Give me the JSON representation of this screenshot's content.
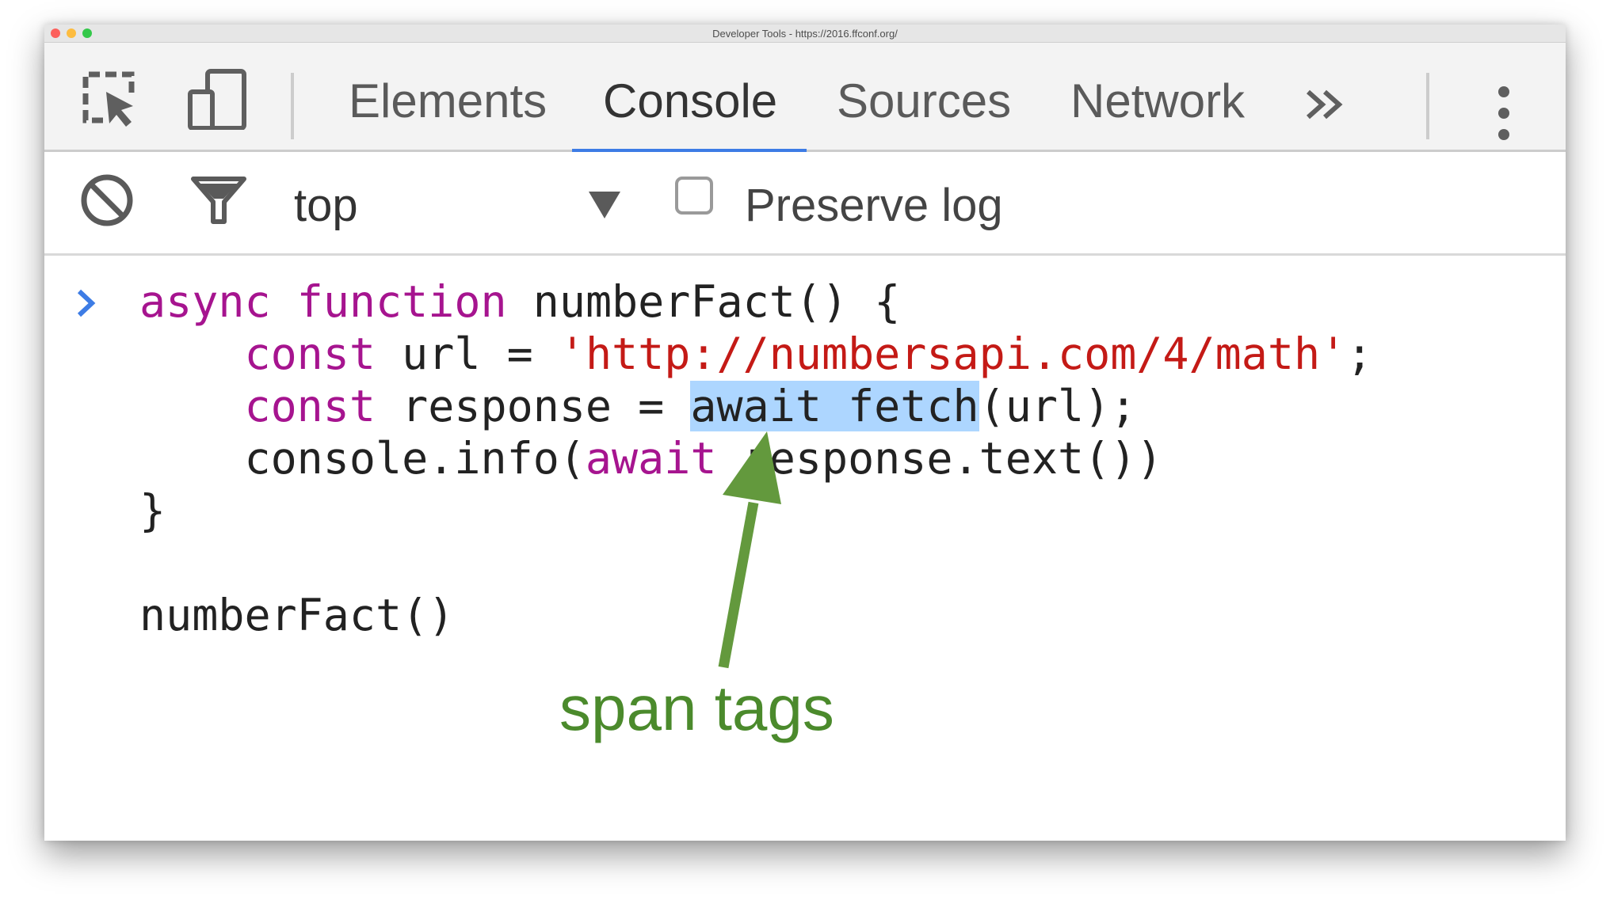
{
  "window": {
    "title": "Developer Tools - https://2016.ffconf.org/"
  },
  "toolbar_icons": {
    "inspect": "inspect-element-icon",
    "device": "device-toolbar-icon",
    "more_tabs": "double-chevron-right-icon",
    "menu": "vertical-dots-icon"
  },
  "tabs": [
    {
      "label": "Elements",
      "active": false
    },
    {
      "label": "Console",
      "active": true
    },
    {
      "label": "Sources",
      "active": false
    },
    {
      "label": "Network",
      "active": false
    }
  ],
  "console_toolbar": {
    "context": "top",
    "preserve_log_label": "Preserve log",
    "preserve_log_checked": false
  },
  "code": {
    "line1": {
      "kw1": "async",
      "sp1": " ",
      "kw2": "function",
      "rest": " numberFact() {"
    },
    "line2": {
      "indent": "    ",
      "kw": "const",
      "mid": " url = ",
      "str": "'http://numbersapi.com/4/math'",
      "end": ";"
    },
    "line3": {
      "indent": "    ",
      "kw": "const",
      "mid": " response = ",
      "sel": "await fetch",
      "end": "(url);"
    },
    "line4": {
      "indent": "    ",
      "pre": "console.info(",
      "kw": "await",
      "end": " response.text())"
    },
    "line5": "}",
    "line7": "numberFact()"
  },
  "annotation": {
    "text": "span tags",
    "color": "#4b8a2c"
  },
  "colors": {
    "accent": "#3d7ce5",
    "keyword": "#a6148f",
    "string": "#c41a16",
    "selection": "#add6ff"
  }
}
